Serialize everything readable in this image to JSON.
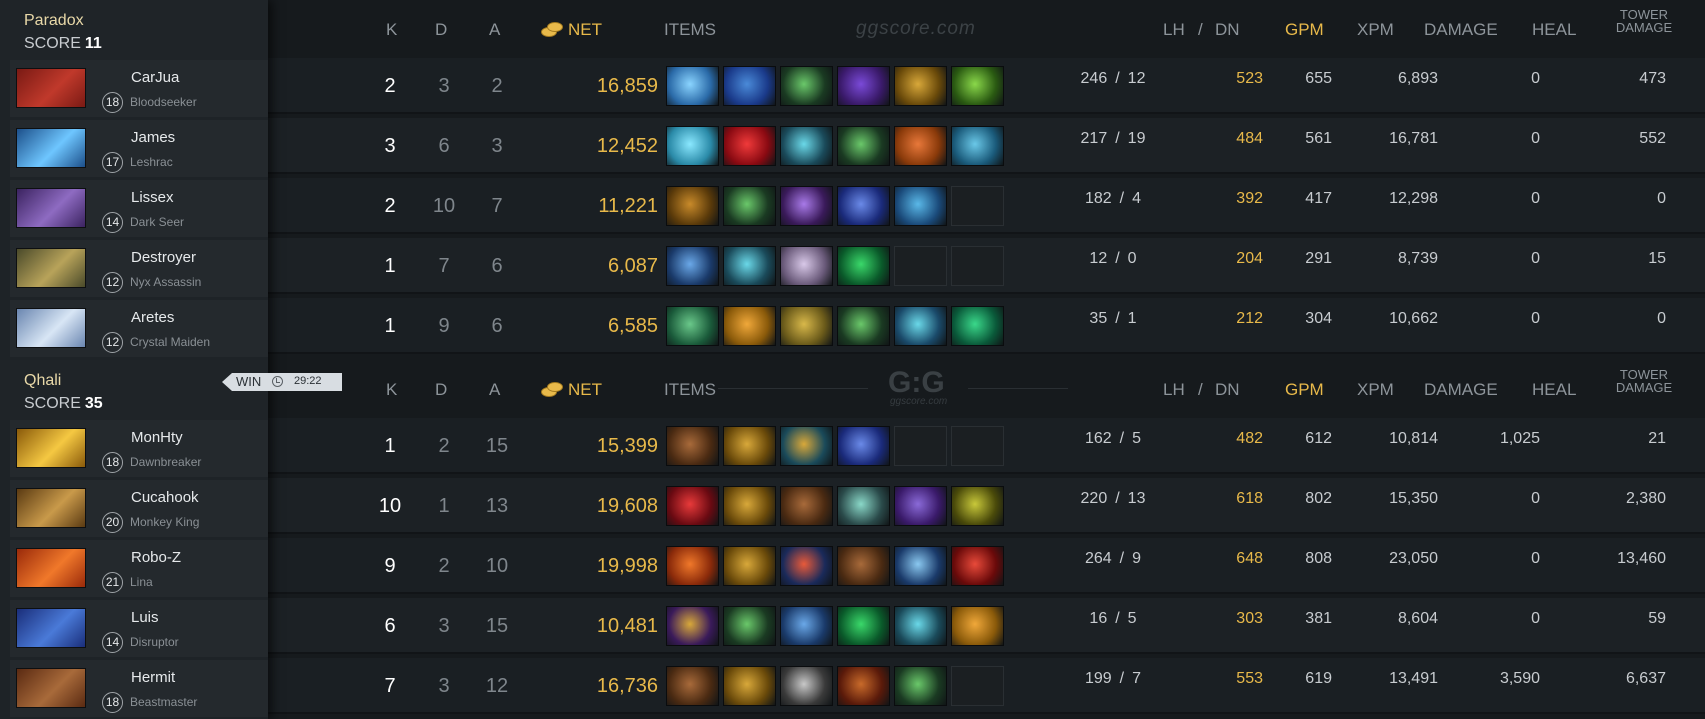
{
  "columns": {
    "k": "K",
    "d": "D",
    "a": "A",
    "net": "NET",
    "items": "ITEMS",
    "lh": "LH",
    "slash": "/",
    "dn": "DN",
    "gpm": "GPM",
    "xpm": "XPM",
    "damage": "DAMAGE",
    "heal": "HEAL",
    "tower_line1": "TOWER",
    "tower_line2": "DAMAGE"
  },
  "watermark": {
    "site": "ggscore.com",
    "logo": "G:G",
    "logo_sub": "ggscore.com"
  },
  "teams": [
    {
      "name": "Paradox",
      "score_label": "SCORE",
      "score": "11",
      "players": [
        {
          "name": "CarJua",
          "level": "18",
          "hero": "Bloodseeker",
          "k": "2",
          "d": "3",
          "a": "2",
          "net": "16,859",
          "lh": "246",
          "dn": "12",
          "gpm": "523",
          "xpm": "655",
          "damage": "6,893",
          "heal": "0",
          "tower": "473"
        },
        {
          "name": "James",
          "level": "17",
          "hero": "Leshrac",
          "k": "3",
          "d": "6",
          "a": "3",
          "net": "12,452",
          "lh": "217",
          "dn": "19",
          "gpm": "484",
          "xpm": "561",
          "damage": "16,781",
          "heal": "0",
          "tower": "552"
        },
        {
          "name": "Lissex",
          "level": "14",
          "hero": "Dark Seer",
          "k": "2",
          "d": "10",
          "a": "7",
          "net": "11,221",
          "lh": "182",
          "dn": "4",
          "gpm": "392",
          "xpm": "417",
          "damage": "12,298",
          "heal": "0",
          "tower": "0"
        },
        {
          "name": "Destroyer",
          "level": "12",
          "hero": "Nyx Assassin",
          "k": "1",
          "d": "7",
          "a": "6",
          "net": "6,087",
          "lh": "12",
          "dn": "0",
          "gpm": "204",
          "xpm": "291",
          "damage": "8,739",
          "heal": "0",
          "tower": "15"
        },
        {
          "name": "Aretes",
          "level": "12",
          "hero": "Crystal Maiden",
          "k": "1",
          "d": "9",
          "a": "6",
          "net": "6,585",
          "lh": "35",
          "dn": "1",
          "gpm": "212",
          "xpm": "304",
          "damage": "10,662",
          "heal": "0",
          "tower": "0"
        }
      ]
    },
    {
      "name": "Qhali",
      "score_label": "SCORE",
      "score": "35",
      "result": "WIN",
      "duration": "29:22",
      "players": [
        {
          "name": "MonHty",
          "level": "18",
          "hero": "Dawnbreaker",
          "k": "1",
          "d": "2",
          "a": "15",
          "net": "15,399",
          "lh": "162",
          "dn": "5",
          "gpm": "482",
          "xpm": "612",
          "damage": "10,814",
          "heal": "1,025",
          "tower": "21"
        },
        {
          "name": "Cucahook",
          "level": "20",
          "hero": "Monkey King",
          "k": "10",
          "d": "1",
          "a": "13",
          "net": "19,608",
          "lh": "220",
          "dn": "13",
          "gpm": "618",
          "xpm": "802",
          "damage": "15,350",
          "heal": "0",
          "tower": "2,380"
        },
        {
          "name": "Robo-Z",
          "level": "21",
          "hero": "Lina",
          "k": "9",
          "d": "2",
          "a": "10",
          "net": "19,998",
          "lh": "264",
          "dn": "9",
          "gpm": "648",
          "xpm": "808",
          "damage": "23,050",
          "heal": "0",
          "tower": "13,460"
        },
        {
          "name": "Luis",
          "level": "14",
          "hero": "Disruptor",
          "k": "6",
          "d": "3",
          "a": "15",
          "net": "10,481",
          "lh": "16",
          "dn": "5",
          "gpm": "303",
          "xpm": "381",
          "damage": "8,604",
          "heal": "0",
          "tower": "59"
        },
        {
          "name": "Hermit",
          "level": "18",
          "hero": "Beastmaster",
          "k": "7",
          "d": "3",
          "a": "12",
          "net": "16,736",
          "lh": "199",
          "dn": "7",
          "gpm": "553",
          "xpm": "619",
          "damage": "13,491",
          "heal": "3,590",
          "tower": "6,637"
        }
      ]
    }
  ],
  "hero_colors": [
    [
      "#7a1a14",
      "#c0392b"
    ],
    [
      "#1c4f8a",
      "#6ec6ff"
    ],
    [
      "#3b2360",
      "#8e6bc2"
    ],
    [
      "#4a4a2a",
      "#b8a35a"
    ],
    [
      "#6a86b0",
      "#d8e6f5"
    ],
    [
      "#8a5a0a",
      "#f5c842"
    ],
    [
      "#5a3a12",
      "#c99a4a"
    ],
    [
      "#9a2a0a",
      "#f0782a"
    ],
    [
      "#1a2e7a",
      "#4a7ad8"
    ],
    [
      "#5a2a12",
      "#a86a3a"
    ]
  ],
  "items": [
    [
      [
        "#2a6aa8",
        "#8ad4ff"
      ],
      [
        "#1a3a8a",
        "#4a8ad8"
      ],
      [
        "#1a3a22",
        "#6ac86a"
      ],
      [
        "#3a1a6a",
        "#7a4ad8"
      ],
      [
        "#6a4a0a",
        "#d8a83a"
      ],
      [
        "#2a5a12",
        "#8ad84a"
      ]
    ],
    [
      [
        "#2a8aa8",
        "#8ae8ff"
      ],
      [
        "#8a0a12",
        "#f03a3a"
      ],
      [
        "#1a4a5a",
        "#6ad8e8"
      ],
      [
        "#1a3a22",
        "#6ac86a"
      ],
      [
        "#8a3a0a",
        "#e8783a"
      ],
      [
        "#1a5a7a",
        "#6ac8e8"
      ]
    ],
    [
      [
        "#5a3a0a",
        "#c88a2a"
      ],
      [
        "#1a3a22",
        "#6ac86a"
      ],
      [
        "#3a1a5a",
        "#a87ae8"
      ],
      [
        "#1a2a7a",
        "#6a8ae8"
      ],
      [
        "#1a4a7a",
        "#5ab8e8"
      ],
      null
    ],
    [
      [
        "#1a3a6a",
        "#6aa8e8"
      ],
      [
        "#1a4a5a",
        "#6ad8e8"
      ],
      [
        "#6a5a7a",
        "#d8c8e8"
      ],
      [
        "#0a5a2a",
        "#3ad86a"
      ],
      null,
      null
    ],
    [
      [
        "#1a5a3a",
        "#6ac88a"
      ],
      [
        "#8a5a0a",
        "#f0a83a"
      ],
      [
        "#6a5a1a",
        "#d8b84a"
      ],
      [
        "#1a3a22",
        "#6ac86a"
      ],
      [
        "#1a4a6a",
        "#6ad8e8"
      ],
      [
        "#0a5a3a",
        "#3ad88a"
      ]
    ],
    [
      [
        "#4a2a12",
        "#a86a3a"
      ],
      [
        "#6a4a0a",
        "#d8a83a"
      ],
      [
        "#1a4a5a",
        "#d8a83a"
      ],
      [
        "#1a2a7a",
        "#6a8ae8"
      ],
      null,
      null
    ],
    [
      [
        "#6a0a12",
        "#e83a3a"
      ],
      [
        "#6a4a0a",
        "#d8a83a"
      ],
      [
        "#4a2a12",
        "#a86a3a"
      ],
      [
        "#2a4a4a",
        "#8ad8c8"
      ],
      [
        "#3a1a6a",
        "#8a6ad8"
      ],
      [
        "#4a4a0a",
        "#c8c83a"
      ]
    ],
    [
      [
        "#8a2a0a",
        "#f0782a"
      ],
      [
        "#6a4a0a",
        "#d8a83a"
      ],
      [
        "#1a2a5a",
        "#e85a3a"
      ],
      [
        "#4a2a12",
        "#a86a3a"
      ],
      [
        "#1a3a6a",
        "#8ac8f0"
      ],
      [
        "#6a0a0a",
        "#e84a3a"
      ]
    ],
    [
      [
        "#3a1a5a",
        "#d8a83a"
      ],
      [
        "#1a3a22",
        "#6ac86a"
      ],
      [
        "#1a3a6a",
        "#6aa8e8"
      ],
      [
        "#0a5a2a",
        "#3ad86a"
      ],
      [
        "#1a4a5a",
        "#6ad8e8"
      ],
      [
        "#8a5a0a",
        "#f0a83a"
      ]
    ],
    [
      [
        "#4a2a12",
        "#a86a3a"
      ],
      [
        "#6a4a0a",
        "#d8a83a"
      ],
      [
        "#3a3a3a",
        "#c8c8c8"
      ],
      [
        "#5a1a0a",
        "#c86a2a"
      ],
      [
        "#1a3a22",
        "#6ac86a"
      ],
      null
    ]
  ]
}
